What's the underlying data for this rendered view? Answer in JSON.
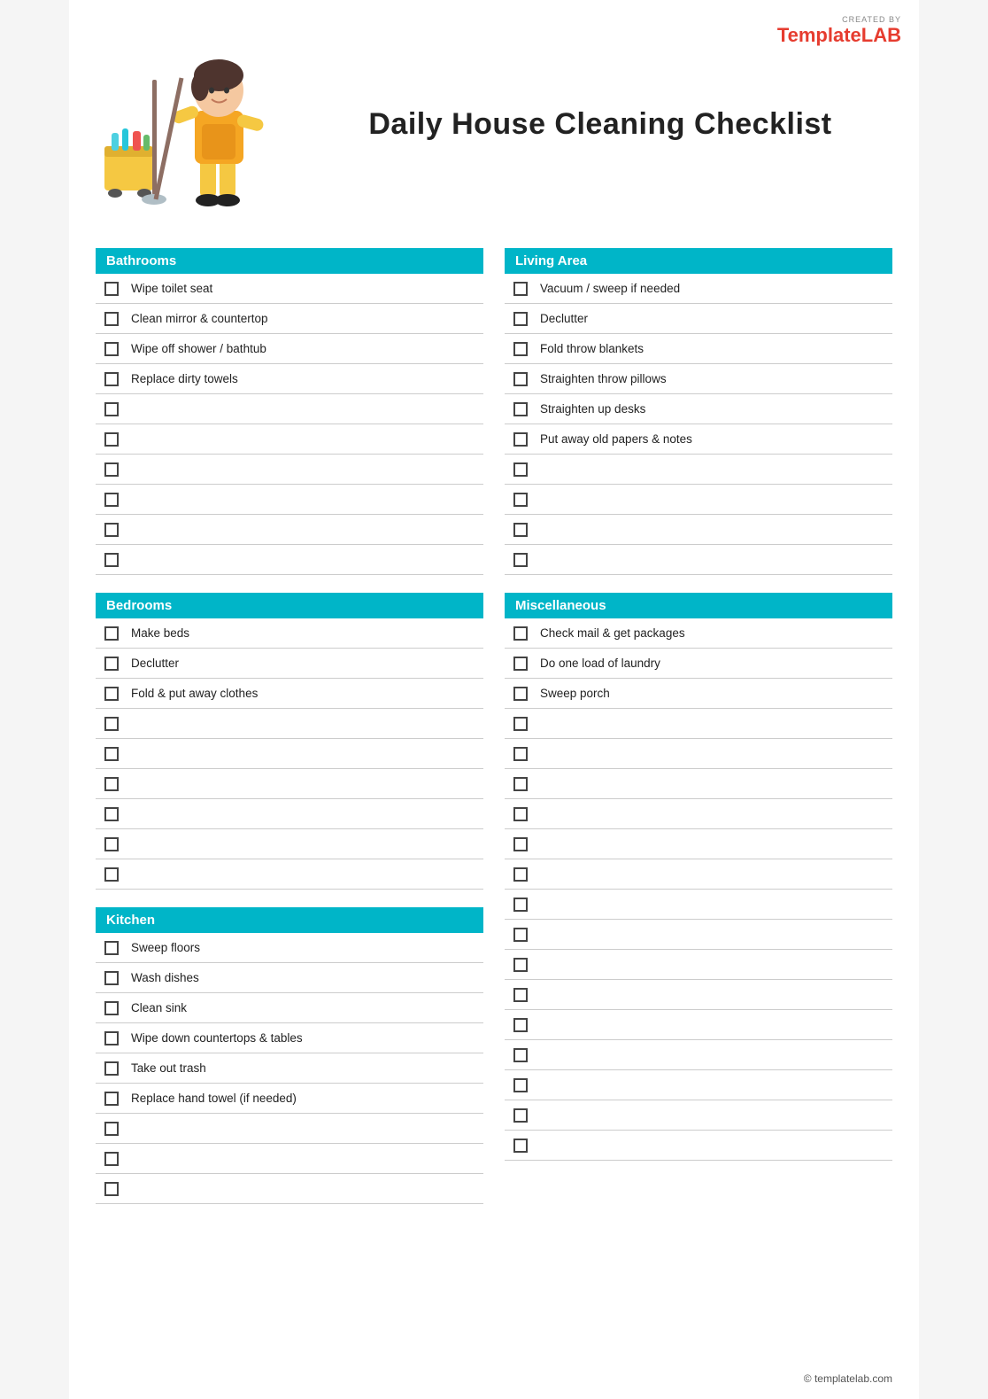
{
  "logo": {
    "created_by": "CREATED BY",
    "brand_part1": "Template",
    "brand_part2": "LAB"
  },
  "header": {
    "title": "Daily House Cleaning Checklist"
  },
  "sections": {
    "left": [
      {
        "id": "bathrooms",
        "header": "Bathrooms",
        "items": [
          "Wipe toilet seat",
          "Clean mirror & countertop",
          "Wipe off shower / bathtub",
          "Replace dirty towels",
          "",
          "",
          "",
          "",
          "",
          ""
        ]
      },
      {
        "id": "bedrooms",
        "header": "Bedrooms",
        "items": [
          "Make beds",
          "Declutter",
          "Fold & put away clothes",
          "",
          "",
          "",
          "",
          "",
          ""
        ]
      },
      {
        "id": "kitchen",
        "header": "Kitchen",
        "items": [
          "Sweep floors",
          "Wash dishes",
          "Clean sink",
          "Wipe down countertops & tables",
          "Take out trash",
          "Replace hand towel (if needed)",
          "",
          "",
          ""
        ]
      }
    ],
    "right": [
      {
        "id": "living-area",
        "header": "Living Area",
        "items": [
          "Vacuum / sweep if needed",
          "Declutter",
          "Fold throw blankets",
          "Straighten throw pillows",
          "Straighten up desks",
          "Put away old papers & notes",
          "",
          "",
          "",
          ""
        ]
      },
      {
        "id": "miscellaneous",
        "header": "Miscellaneous",
        "items": [
          "Check mail & get packages",
          "Do one load of laundry",
          "Sweep porch",
          "",
          "",
          "",
          "",
          "",
          "",
          "",
          "",
          "",
          "",
          "",
          ""
        ]
      }
    ]
  },
  "footer": {
    "text": "© templatelab.com"
  }
}
